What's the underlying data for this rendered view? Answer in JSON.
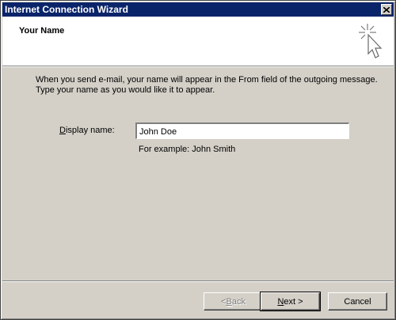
{
  "window": {
    "title": "Internet Connection Wizard",
    "close_icon": "close-icon"
  },
  "header": {
    "title": "Your Name",
    "icon": "wizard-cursor-sparkle-icon"
  },
  "body": {
    "description_line1": "When you send e-mail, your name will appear in the From field of the outgoing message.",
    "description_line2": "Type your name as you would like it to appear."
  },
  "form": {
    "display_name_label_accel": "D",
    "display_name_label_rest": "isplay name:",
    "display_name_value": "John Doe",
    "example_text": "For example: John Smith"
  },
  "buttons": {
    "back_prefix": "< ",
    "back_accel": "B",
    "back_rest": "ack",
    "back_enabled": false,
    "next_accel": "N",
    "next_rest": "ext >",
    "cancel_label": "Cancel"
  },
  "colors": {
    "title_bar": "#0a246a",
    "dialog_face": "#d4d0c8",
    "header_bg": "#ffffff"
  }
}
